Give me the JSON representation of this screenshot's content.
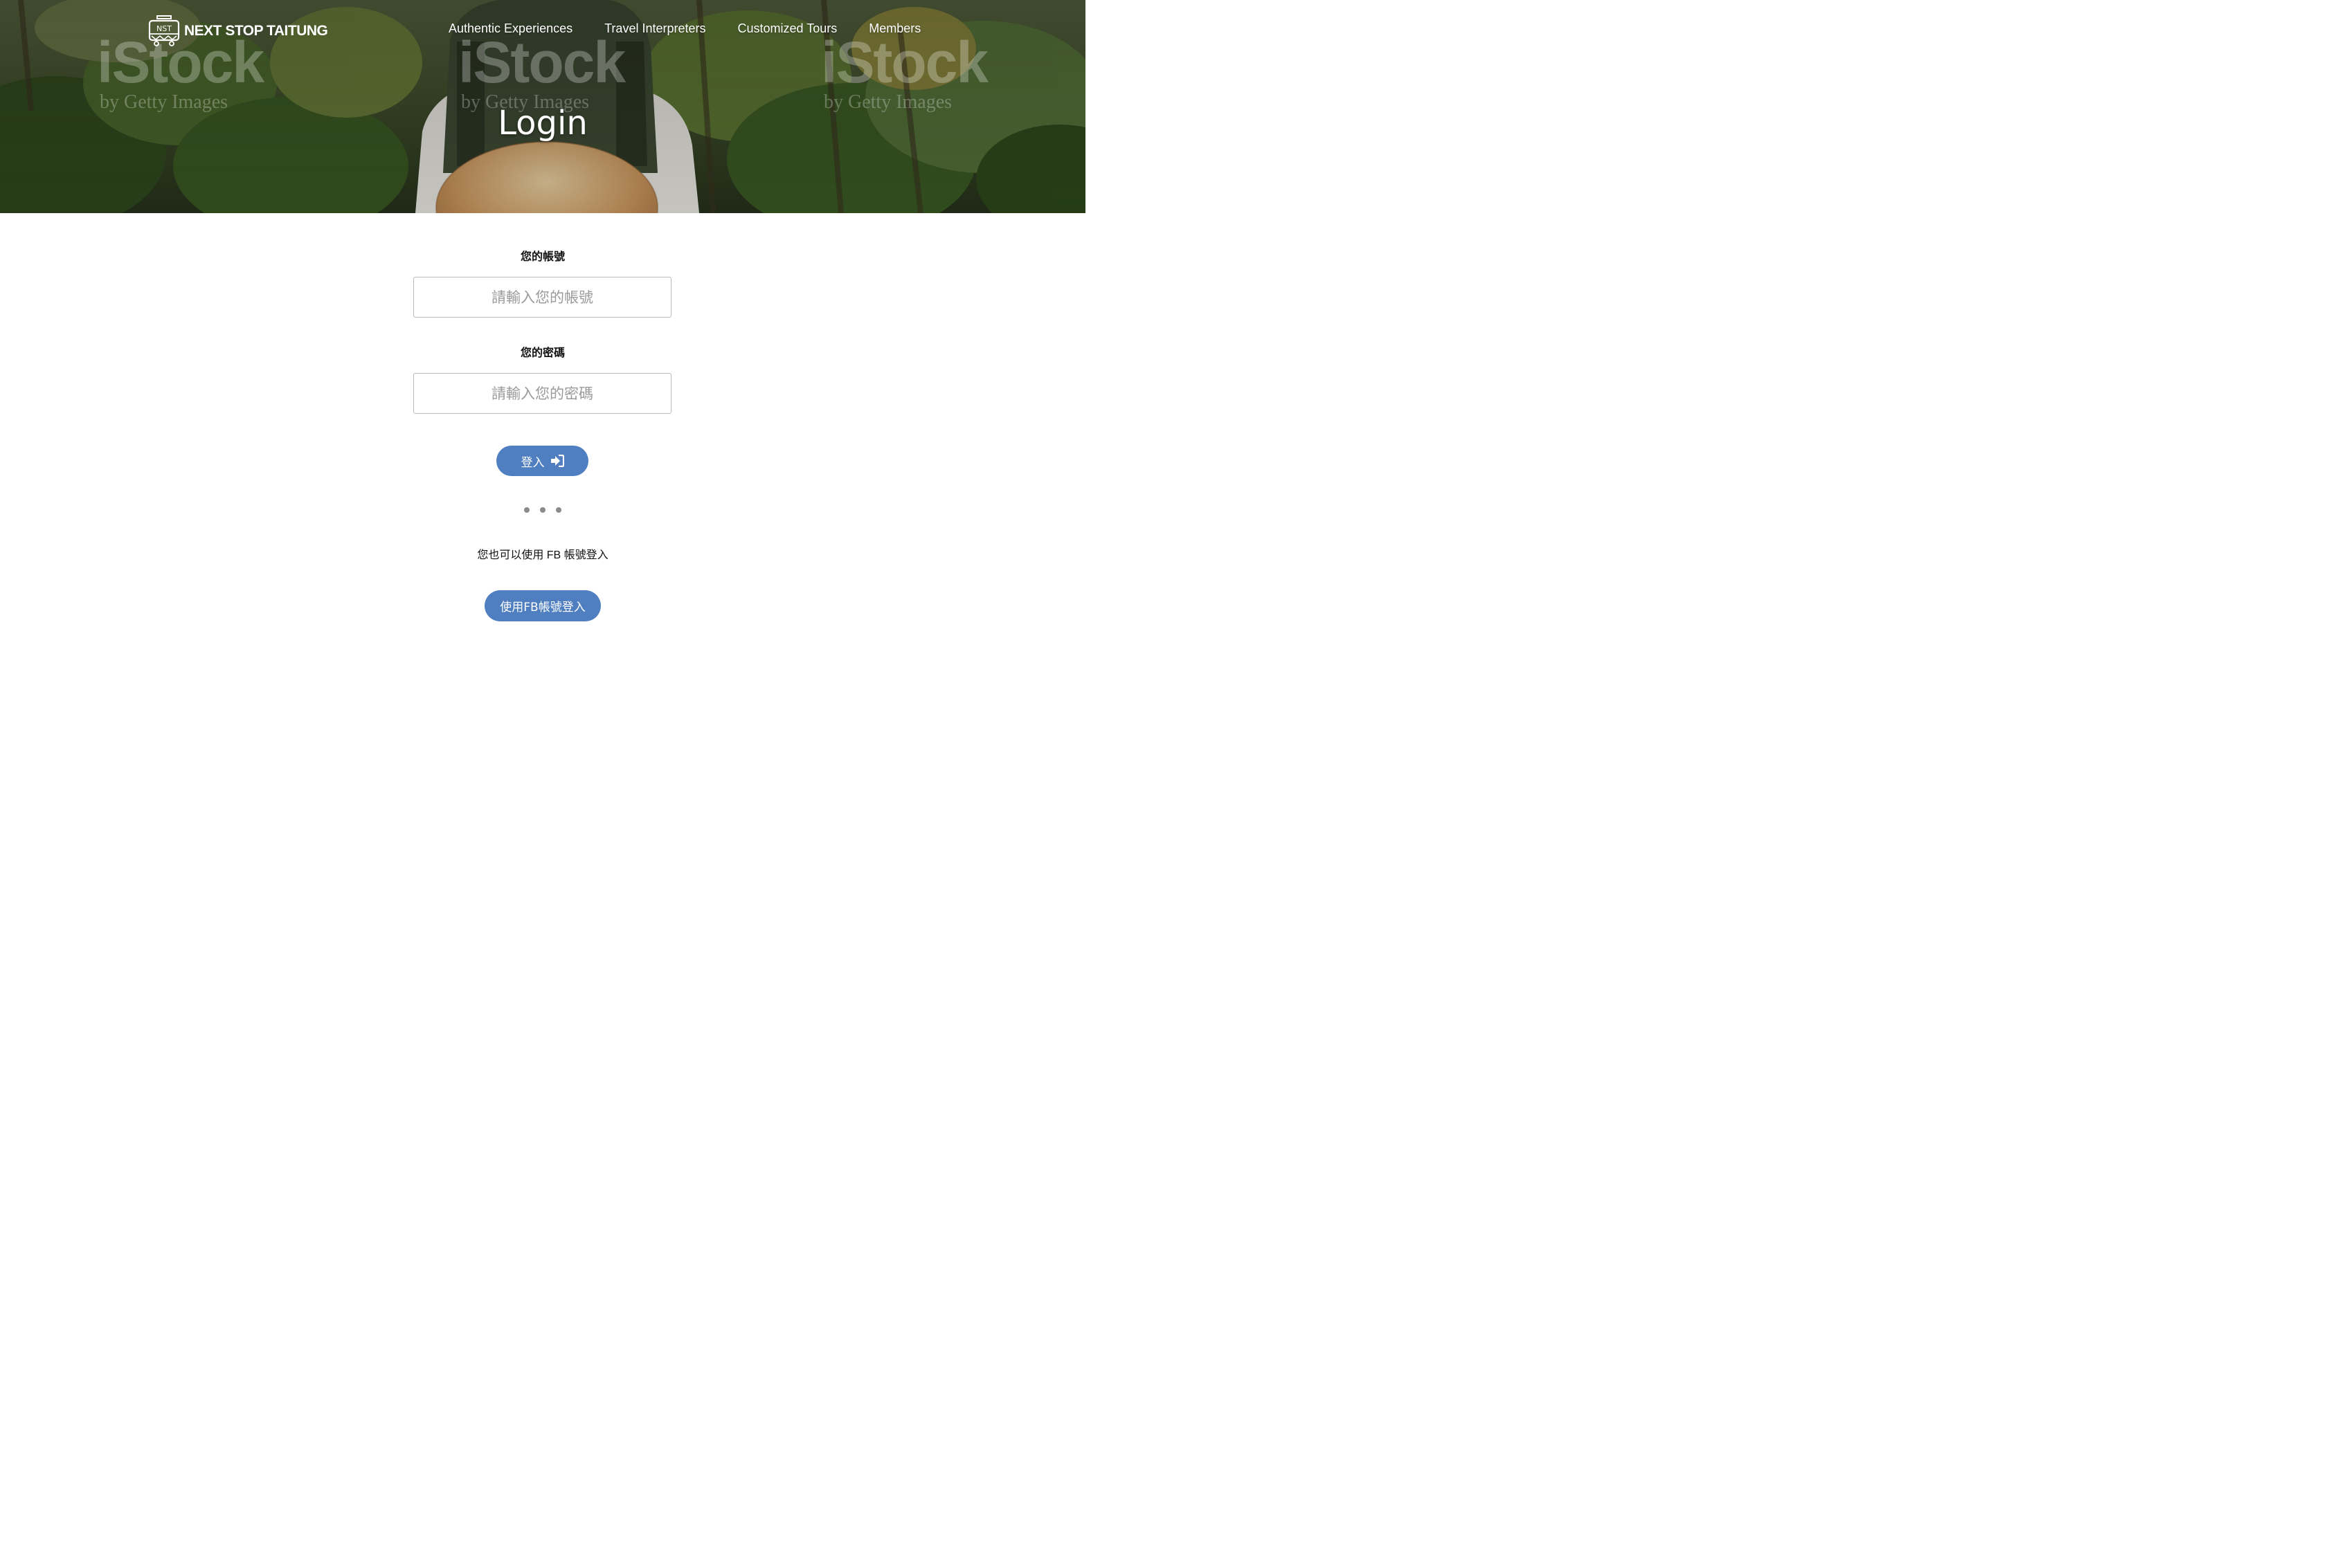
{
  "brand": {
    "name": "NEXT STOP TAITUNG",
    "mark_text": "NST"
  },
  "nav": {
    "items": [
      {
        "label": "Authentic Experiences"
      },
      {
        "label": "Travel Interpreters"
      },
      {
        "label": "Customized Tours"
      },
      {
        "label": "Members"
      }
    ]
  },
  "hero": {
    "title": "Login",
    "watermark": {
      "brand": "iStock",
      "tagline": "by Getty Images"
    }
  },
  "form": {
    "account_label": "您的帳號",
    "account_placeholder": "請輸入您的帳號",
    "password_label": "您的密碼",
    "password_placeholder": "請輸入您的密碼",
    "login_label": "登入"
  },
  "alt_login": {
    "note": "您也可以使用 FB 帳號登入",
    "fb_button_label": "使用FB帳號登入"
  },
  "colors": {
    "accent": "#4f7fc0",
    "input_border": "#b9b9b9",
    "dots": "#8a8a8a"
  },
  "icons": {
    "login": "sign-in-icon",
    "logo": "tram-icon"
  }
}
